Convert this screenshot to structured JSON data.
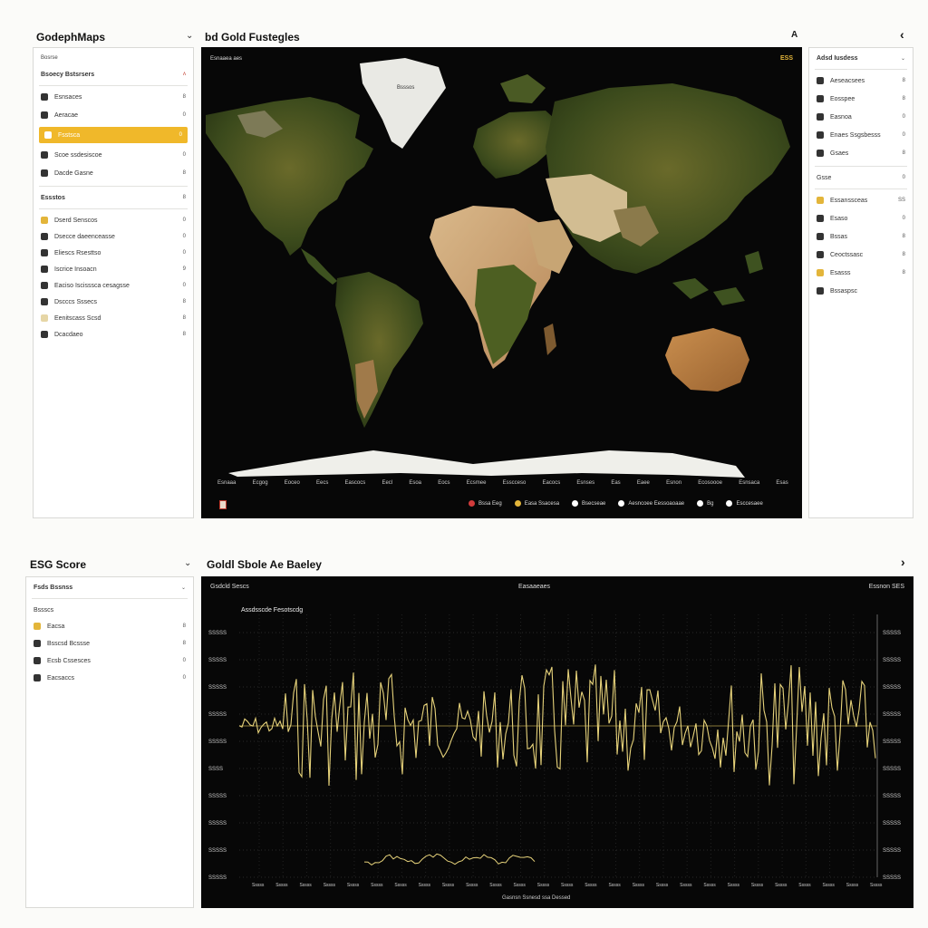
{
  "top": {
    "app_title": "GodephMaps",
    "map_title": "bd Gold Fustegles",
    "corner_label": "A",
    "corner_chevron": "‹"
  },
  "left_sidebar": {
    "header": "Bosrse",
    "subheader": "Bsoecy Bstsrsers",
    "subheader_mark": "ʌ",
    "items": [
      {
        "label": "Esnsaces",
        "count": "8",
        "icon": "dark"
      },
      {
        "label": "Aeracae",
        "count": "0",
        "icon": "dark"
      },
      {
        "label": "Fsstsca",
        "count": "0",
        "icon": "gold",
        "active": true
      },
      {
        "label": "Scoe ssdesiscoe",
        "count": "0",
        "icon": "dark"
      },
      {
        "label": "Dacde Gasne",
        "count": "8",
        "icon": "dark"
      }
    ],
    "section": {
      "label": "Essstos",
      "count": "8"
    },
    "section_items": [
      {
        "label": "Dserd Senscos",
        "count": "0",
        "icon": "gold"
      },
      {
        "label": "Dsecce daeenceasse",
        "count": "0",
        "icon": "dark"
      },
      {
        "label": "Eliescs Rsesttso",
        "count": "0",
        "icon": "dark"
      },
      {
        "label": "Iscrice Insoacn",
        "count": "9",
        "icon": "dark"
      },
      {
        "label": "Eaciso Iscisssca cesagsse",
        "count": "0",
        "icon": "dark"
      },
      {
        "label": "Dscccs Sssecs",
        "count": "8",
        "icon": "dark"
      },
      {
        "label": "Eenitscass Scsd",
        "count": "8",
        "icon": "light"
      },
      {
        "label": "Dcacdaeo",
        "count": "8",
        "icon": "dark"
      }
    ]
  },
  "map": {
    "corner_left": "Esnaaea aes",
    "corner_right": "ESS",
    "greenland_label": "Bsssos",
    "axis_labels": [
      "Esnaaa",
      "Ecgog",
      "Eoceo",
      "Eecs",
      "Eascocs",
      "Eecl",
      "Esoa",
      "Eocs",
      "Ecsmee",
      "Esscceso",
      "Eacocs",
      "Esnses",
      "Eas",
      "Eaee",
      "Esnon",
      "Ecosoooe",
      "Esnsaca",
      "Esas"
    ],
    "legend": [
      {
        "label": "Bssa Eeg",
        "color": "#d23b3b"
      },
      {
        "label": "Easa Ssacesa",
        "color": "#e3b53a"
      },
      {
        "label": "Bsecseae",
        "color": "#ffffff"
      },
      {
        "label": "Aesncoee Eessoaoaae",
        "color": "#ffffff"
      },
      {
        "label": "Bg",
        "color": "#ffffff"
      },
      {
        "label": "Esccesaee",
        "color": "#ffffff"
      }
    ]
  },
  "right_sidebar": {
    "header": "Adsd Iusdess",
    "items": [
      {
        "label": "Aeseacsees",
        "count": "8"
      },
      {
        "label": "Eosspee",
        "count": "8"
      },
      {
        "label": "Easnoa",
        "count": "0"
      },
      {
        "label": "Enaes Ssgsbesss",
        "count": "0"
      },
      {
        "label": "Gsaes",
        "count": "8"
      }
    ],
    "section": {
      "label": "Gsse",
      "count": "0"
    },
    "section_items": [
      {
        "label": "Essanssceas",
        "count": "SS",
        "icon": "gold"
      },
      {
        "label": "Esaso",
        "count": "0",
        "icon": "dark"
      },
      {
        "label": "Bssas",
        "count": "8",
        "icon": "dark"
      },
      {
        "label": "Ceoctssasc",
        "count": "8",
        "icon": "dark"
      },
      {
        "label": "Esasss",
        "count": "8",
        "icon": "gold"
      },
      {
        "label": "Bssaspsc",
        "count": "",
        "icon": "dark"
      }
    ]
  },
  "bottom_left": {
    "title": "ESG Score",
    "header": "Fsds Bssnss",
    "section": "Bssscs",
    "items": [
      {
        "label": "Eacsa",
        "count": "8",
        "icon": "gold"
      },
      {
        "label": "Bsscsd Bcssse",
        "count": "8",
        "icon": "dark"
      },
      {
        "label": "Ecsb Cssesces",
        "count": "0",
        "icon": "dark"
      },
      {
        "label": "Eacsaccs",
        "count": "0",
        "icon": "dark"
      }
    ]
  },
  "chart_panel": {
    "title": "Goldl Sbole Ae Baeley",
    "chevron": "›",
    "hdr_left": "Gsdcld Sescs",
    "hdr_center": "Easaaeaes",
    "hdr_right": "Essnon SES",
    "inner_label": "Assdsscde Fesotscdg",
    "bottom_label": "Gasnsn Ssnesd ssa Dessed",
    "y_labels_left": [
      "SSSSS",
      "SSSSS",
      "SSSSS",
      "SSSSS",
      "SSSSS",
      "SSSS",
      "SSSSS",
      "SSSSS",
      "SSSSS",
      "SSSSS"
    ],
    "y_labels_right": [
      "SSSSS",
      "SSSSS",
      "SSSSS",
      "SSSSS",
      "SSSSS",
      "SSSSS",
      "SSSSS",
      "SSSSS",
      "SSSSS",
      "SSSSS"
    ],
    "x_labels": [
      "Sssss",
      "Sssss",
      "Sssss",
      "Sssss",
      "Sssss",
      "Sssss",
      "Sssss",
      "Sssss",
      "Sssss",
      "Sssss",
      "Sssss",
      "Sssss",
      "Sssss",
      "Sssss",
      "Sssss",
      "Sssss",
      "Sssss",
      "Sssss",
      "Sssss",
      "Sssss",
      "Sssss",
      "Sssss",
      "Sssss",
      "Sssss",
      "Sssss",
      "Sssss",
      "Sssss"
    ],
    "line_color": "#e6d27a"
  }
}
